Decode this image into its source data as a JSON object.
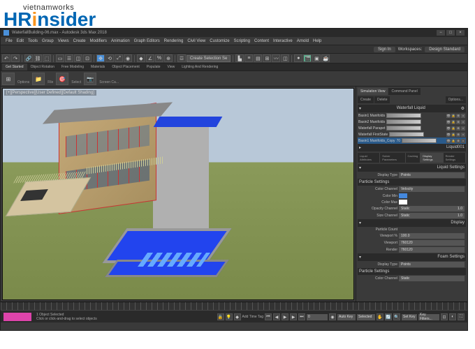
{
  "logo": {
    "top": "vietnamworks",
    "bottom_hr": "HR",
    "bottom_i": "i",
    "bottom_rest": "nsider"
  },
  "titlebar": {
    "title": "WaterfallBuilding-06.max - Autodesk 3ds Max 2018"
  },
  "menu": [
    "File",
    "Edit",
    "Tools",
    "Group",
    "Views",
    "Create",
    "Modifiers",
    "Animation",
    "Graph Editors",
    "Rendering",
    "Civil View",
    "Customize",
    "Scripting",
    "Content",
    "Interactive",
    "Arnold",
    "Help"
  ],
  "signin": {
    "label": "Sign In",
    "workspace_label": "Workspaces:",
    "workspace": "Design Standard"
  },
  "toolbar_dropdown": "Create Selection Se",
  "tabs": [
    "Get Started",
    "Object Rotation",
    "Free Modeling",
    "Materials",
    "Object Placement",
    "Populate",
    "View",
    "Lighting And Rendering"
  ],
  "ribbon": [
    {
      "icon": "⊞",
      "label": "Options"
    },
    {
      "icon": "📁",
      "label": "File"
    },
    {
      "icon": "🎯",
      "label": "Select"
    },
    {
      "icon": "📷",
      "label": "Screen Ca..."
    }
  ],
  "viewport": {
    "label": "[+][Perspective][User Defined][Default Shading]"
  },
  "panel": {
    "tabs": [
      "Simulation View",
      "Command Panel"
    ],
    "row2": [
      "Create",
      "Delete",
      "",
      "Options..."
    ],
    "liquid_header": "Waterfall Liquid",
    "layers": [
      {
        "name": "Basin1 Manifolds",
        "selected": false
      },
      {
        "name": "Basin2 Manifolds",
        "selected": false
      },
      {
        "name": "Waterfall Parapet",
        "selected": false
      },
      {
        "name": "Waterfall FirstState",
        "selected": false
      },
      {
        "name": "Basin1 Manifolds_Copy",
        "selected": true,
        "count": "70"
      }
    ],
    "liquid_count": "Liquid001",
    "subtabs": [
      "Liquid Attributes",
      "Solver Parameters",
      "Caching",
      "Display Settings",
      "Render Settings"
    ],
    "liquid_settings": {
      "header": "Liquid Settings",
      "display_type_label": "Display Type",
      "display_type": "Points"
    },
    "particle_settings": {
      "header": "Particle Settings",
      "rows": [
        {
          "label": "Color Channel",
          "val": "Velocity"
        },
        {
          "label": "Color Min",
          "swatch": "#4488dd"
        },
        {
          "label": "Color Max",
          "swatch": "#ffffff"
        },
        {
          "label": "Opacity Channel",
          "val": "Static",
          "num": "1.0"
        },
        {
          "label": "Size Channel",
          "val": "Static",
          "num": "1.0"
        }
      ]
    },
    "display": {
      "header": "Display",
      "rows": [
        {
          "label": "Particle Count",
          "val": ""
        },
        {
          "label": "Viewport %",
          "val": "100.0"
        },
        {
          "label": "Viewport",
          "val": "760120"
        },
        {
          "label": "Render",
          "val": "760120"
        }
      ]
    },
    "foam": {
      "header": "Foam Settings",
      "display_type_label": "Display Type",
      "display_type": "Points",
      "color_label": "Color Channel",
      "color_val": "Static"
    }
  },
  "timeline": {
    "selection_info": "1 Object Selected",
    "hint": "Click or click-and-drag to select objects",
    "frame": "0",
    "add_time_tag": "Add Time Tag",
    "autokey": "Auto Key",
    "setkey": "Set Key",
    "selected": "Selected",
    "keyfilters": "Key Filters..."
  }
}
